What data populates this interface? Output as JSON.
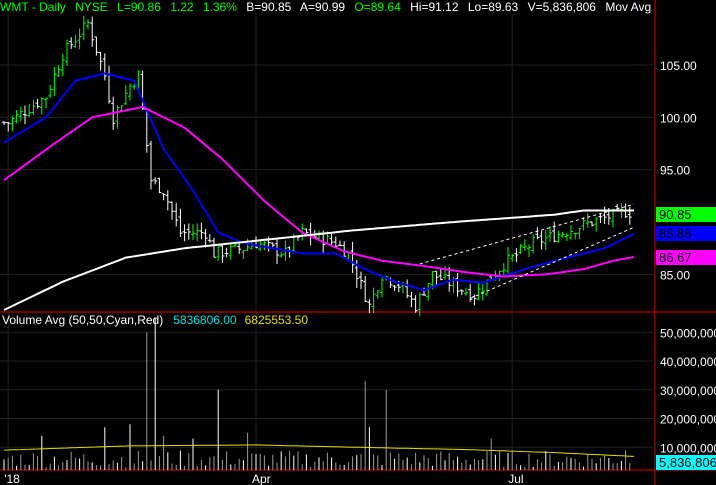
{
  "header": {
    "symbol": "WMT - Daily",
    "exchange": "NYSE",
    "last": "L=90.86",
    "change": "1.22",
    "change_pct": "1.36%",
    "bid": "B=90.85",
    "ask": "A=90.99",
    "open": "O=89.64",
    "high": "Hi=91.12",
    "low": "Lo=89.63",
    "volume": "V=5,836,806",
    "study": "Mov Avg 2 Lines (Close,2( ..."
  },
  "volume_header": {
    "label": "Volume Avg (50,50,Cyan,Red)",
    "value1": "5836806.00",
    "value2": "6825553.50"
  },
  "badges": {
    "last": "90.85",
    "ma_blue": "88.88",
    "ma_magenta": "86.67",
    "volume": "5,836,806"
  },
  "colors": {
    "up": "#00ff00",
    "ma_fast": "#0000ff",
    "ma_slow": "#ff00ff",
    "ma_long": "#ffffff",
    "volume_avg": "#e0e000",
    "volume_badge": "#00ffff"
  },
  "chart_data": {
    "type": "line",
    "title": "WMT - Daily",
    "x_ticks": [
      {
        "label": "'18",
        "bar": 1
      },
      {
        "label": "Apr",
        "bar": 60
      },
      {
        "label": "Jul",
        "bar": 121
      }
    ],
    "price_ylim": [
      80.5,
      110
    ],
    "price_ticks": [
      "105.00",
      "100.00",
      "95.00",
      "85.00"
    ],
    "price_tick_values": [
      105,
      100,
      95,
      85
    ],
    "volume_ylim": [
      0,
      55000000
    ],
    "volume_ticks": [
      "50,000,000",
      "40,000,000",
      "30,000,000",
      "20,000,000",
      "10,000,000"
    ],
    "volume_tick_values": [
      50000000,
      40000000,
      30000000,
      20000000,
      10000000
    ],
    "bars_count": 150,
    "close_keypoints": [
      [
        1,
        99.5
      ],
      [
        10,
        102
      ],
      [
        14,
        106
      ],
      [
        20,
        109
      ],
      [
        24,
        104
      ],
      [
        26,
        100
      ],
      [
        30,
        103
      ],
      [
        32,
        104
      ],
      [
        35,
        94
      ],
      [
        38,
        93
      ],
      [
        42,
        89
      ],
      [
        48,
        89
      ],
      [
        50,
        87
      ],
      [
        57,
        87.5
      ],
      [
        60,
        88
      ],
      [
        67,
        87
      ],
      [
        71,
        89
      ],
      [
        79,
        88
      ],
      [
        82,
        87
      ],
      [
        87,
        82
      ],
      [
        90,
        85
      ],
      [
        94,
        84
      ],
      [
        98,
        82
      ],
      [
        102,
        85
      ],
      [
        107,
        84
      ],
      [
        112,
        83
      ],
      [
        119,
        86
      ],
      [
        126,
        88
      ],
      [
        133,
        89
      ],
      [
        140,
        90
      ],
      [
        148,
        91
      ],
      [
        150,
        90.86
      ]
    ],
    "series": [
      {
        "name": "MA fast",
        "color": "#0000ff",
        "keypoints": [
          [
            0,
            97.6
          ],
          [
            10,
            100
          ],
          [
            17,
            103.5
          ],
          [
            24,
            104.2
          ],
          [
            31,
            103.5
          ],
          [
            38,
            97
          ],
          [
            45,
            93
          ],
          [
            51,
            89
          ],
          [
            57,
            88
          ],
          [
            71,
            87
          ],
          [
            79,
            87
          ],
          [
            86,
            85.5
          ],
          [
            93,
            84.3
          ],
          [
            100,
            83.5
          ],
          [
            107,
            84.5
          ],
          [
            114,
            84.2
          ],
          [
            124,
            85.5
          ],
          [
            133,
            86.5
          ],
          [
            143,
            87.5
          ],
          [
            150,
            88.88
          ]
        ]
      },
      {
        "name": "MA slow",
        "color": "#ff00ff",
        "keypoints": [
          [
            0,
            94
          ],
          [
            12,
            97.5
          ],
          [
            21,
            100
          ],
          [
            33,
            101
          ],
          [
            43,
            99
          ],
          [
            52,
            96
          ],
          [
            62,
            92
          ],
          [
            71,
            89
          ],
          [
            81,
            87.2
          ],
          [
            90,
            86.3
          ],
          [
            100,
            85.8
          ],
          [
            110,
            85.2
          ],
          [
            119,
            84.8
          ],
          [
            129,
            85
          ],
          [
            138,
            85.5
          ],
          [
            145,
            86.3
          ],
          [
            150,
            86.67
          ]
        ]
      },
      {
        "name": "MA long",
        "color": "#ffffff",
        "keypoints": [
          [
            0,
            81.6
          ],
          [
            14,
            84.3
          ],
          [
            29,
            86.6
          ],
          [
            43,
            87.5
          ],
          [
            62,
            88.3
          ],
          [
            83,
            89.2
          ],
          [
            107,
            90
          ],
          [
            131,
            90.7
          ],
          [
            138,
            91.1
          ],
          [
            150,
            91.1
          ]
        ]
      }
    ],
    "trend_channel": {
      "upper": [
        [
          99,
          86
        ],
        [
          150,
          91.7
        ]
      ],
      "lower": [
        [
          111,
          82.7
        ],
        [
          150,
          89.5
        ]
      ]
    },
    "volume_spikes": [
      [
        9,
        14000000
      ],
      [
        24,
        17000000
      ],
      [
        30,
        18000000
      ],
      [
        34,
        50000000
      ],
      [
        36,
        55000000
      ],
      [
        38,
        14000000
      ],
      [
        45,
        13000000
      ],
      [
        51,
        30000000
      ],
      [
        58,
        15000000
      ],
      [
        86,
        33000000
      ],
      [
        87,
        17000000
      ],
      [
        91,
        30000000
      ],
      [
        116,
        13000000
      ],
      [
        148,
        9000000
      ]
    ],
    "volume_avg_keypoints": [
      [
        0,
        9000000
      ],
      [
        30,
        10500000
      ],
      [
        60,
        10800000
      ],
      [
        90,
        9800000
      ],
      [
        110,
        9200000
      ],
      [
        130,
        8200000
      ],
      [
        150,
        6800000
      ]
    ]
  }
}
